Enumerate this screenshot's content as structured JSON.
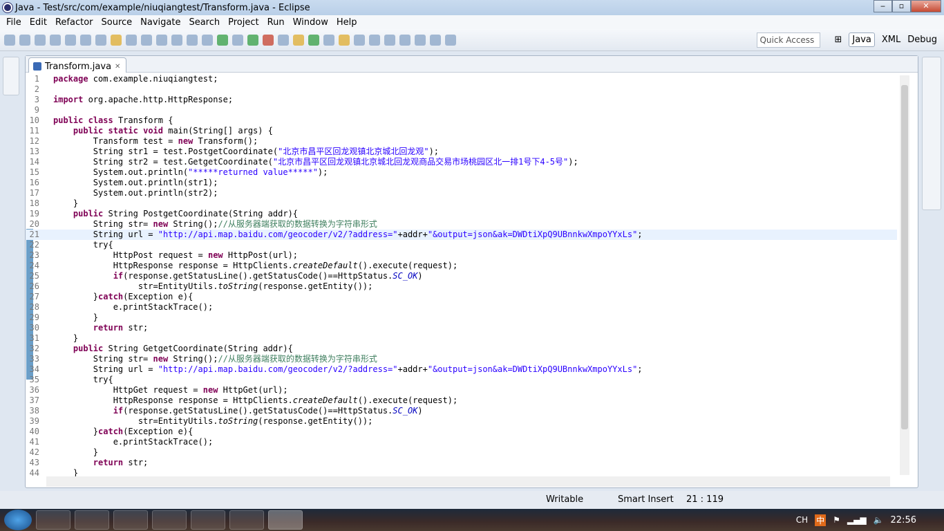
{
  "window": {
    "title": "Java - Test/src/com/example/niuqiangtest/Transform.java - Eclipse",
    "minimize": "‒",
    "maximize": "▫",
    "close": "✕"
  },
  "menu": [
    "File",
    "Edit",
    "Refactor",
    "Source",
    "Navigate",
    "Search",
    "Project",
    "Run",
    "Window",
    "Help"
  ],
  "toolbar": {
    "quick_access": "Quick Access",
    "perspectives": [
      "Java",
      "XML",
      "Debug"
    ]
  },
  "editor": {
    "tab": "Transform.java",
    "tab_close": "✕",
    "lines": [
      [
        "1",
        "package com.example.niuqiangtest;"
      ],
      [
        "2",
        ""
      ],
      [
        "3",
        "import org.apache.http.HttpResponse;"
      ],
      [
        "9",
        ""
      ],
      [
        "10",
        "public class Transform {"
      ],
      [
        "11",
        "    public static void main(String[] args) {"
      ],
      [
        "12",
        "        Transform test = new Transform();"
      ],
      [
        "13",
        "        String str1 = test.PostgetCoordinate(\"北京市昌平区回龙观镇北京城北回龙观\");"
      ],
      [
        "14",
        "        String str2 = test.GetgetCoordinate(\"北京市昌平区回龙观镇北京城北回龙观商品交易市场桃园区北一排1号下4-5号\");"
      ],
      [
        "15",
        "        System.out.println(\"*****returned value*****\");"
      ],
      [
        "16",
        "        System.out.println(str1);"
      ],
      [
        "17",
        "        System.out.println(str2);"
      ],
      [
        "18",
        "    }"
      ],
      [
        "19",
        "    public String PostgetCoordinate(String addr){"
      ],
      [
        "20",
        "        String str= new String();//从服务器端获取的数据转换为字符串形式"
      ],
      [
        "21",
        "        String url = \"http://api.map.baidu.com/geocoder/v2/?address=\"+addr+\"&output=json&ak=DWDtiXpQ9UBnnkwXmpoYYxLs\";"
      ],
      [
        "22",
        "        try{"
      ],
      [
        "23",
        "            HttpPost request = new HttpPost(url);"
      ],
      [
        "24",
        "            HttpResponse response = HttpClients.createDefault().execute(request);"
      ],
      [
        "25",
        "            if(response.getStatusLine().getStatusCode()==HttpStatus.SC_OK)"
      ],
      [
        "26",
        "                 str=EntityUtils.toString(response.getEntity());"
      ],
      [
        "27",
        "        }catch(Exception e){"
      ],
      [
        "28",
        "            e.printStackTrace();"
      ],
      [
        "29",
        "        }"
      ],
      [
        "30",
        "        return str;"
      ],
      [
        "31",
        "    }"
      ],
      [
        "32",
        "    public String GetgetCoordinate(String addr){"
      ],
      [
        "33",
        "        String str= new String();//从服务器端获取的数据转换为字符串形式"
      ],
      [
        "34",
        "        String url = \"http://api.map.baidu.com/geocoder/v2/?address=\"+addr+\"&output=json&ak=DWDtiXpQ9UBnnkwXmpoYYxLs\";"
      ],
      [
        "35",
        "        try{"
      ],
      [
        "36",
        "            HttpGet request = new HttpGet(url);"
      ],
      [
        "37",
        "            HttpResponse response = HttpClients.createDefault().execute(request);"
      ],
      [
        "38",
        "            if(response.getStatusLine().getStatusCode()==HttpStatus.SC_OK)"
      ],
      [
        "39",
        "                 str=EntityUtils.toString(response.getEntity());"
      ],
      [
        "40",
        "        }catch(Exception e){"
      ],
      [
        "41",
        "            e.printStackTrace();"
      ],
      [
        "42",
        "        }"
      ],
      [
        "43",
        "        return str;"
      ],
      [
        "44",
        "    }"
      ]
    ],
    "current_line": "21"
  },
  "status": {
    "writable": "Writable",
    "insert_mode": "Smart Insert",
    "position": "21 : 119"
  },
  "taskbar": {
    "lang": "CH",
    "ime": "中",
    "time": "22:56"
  }
}
